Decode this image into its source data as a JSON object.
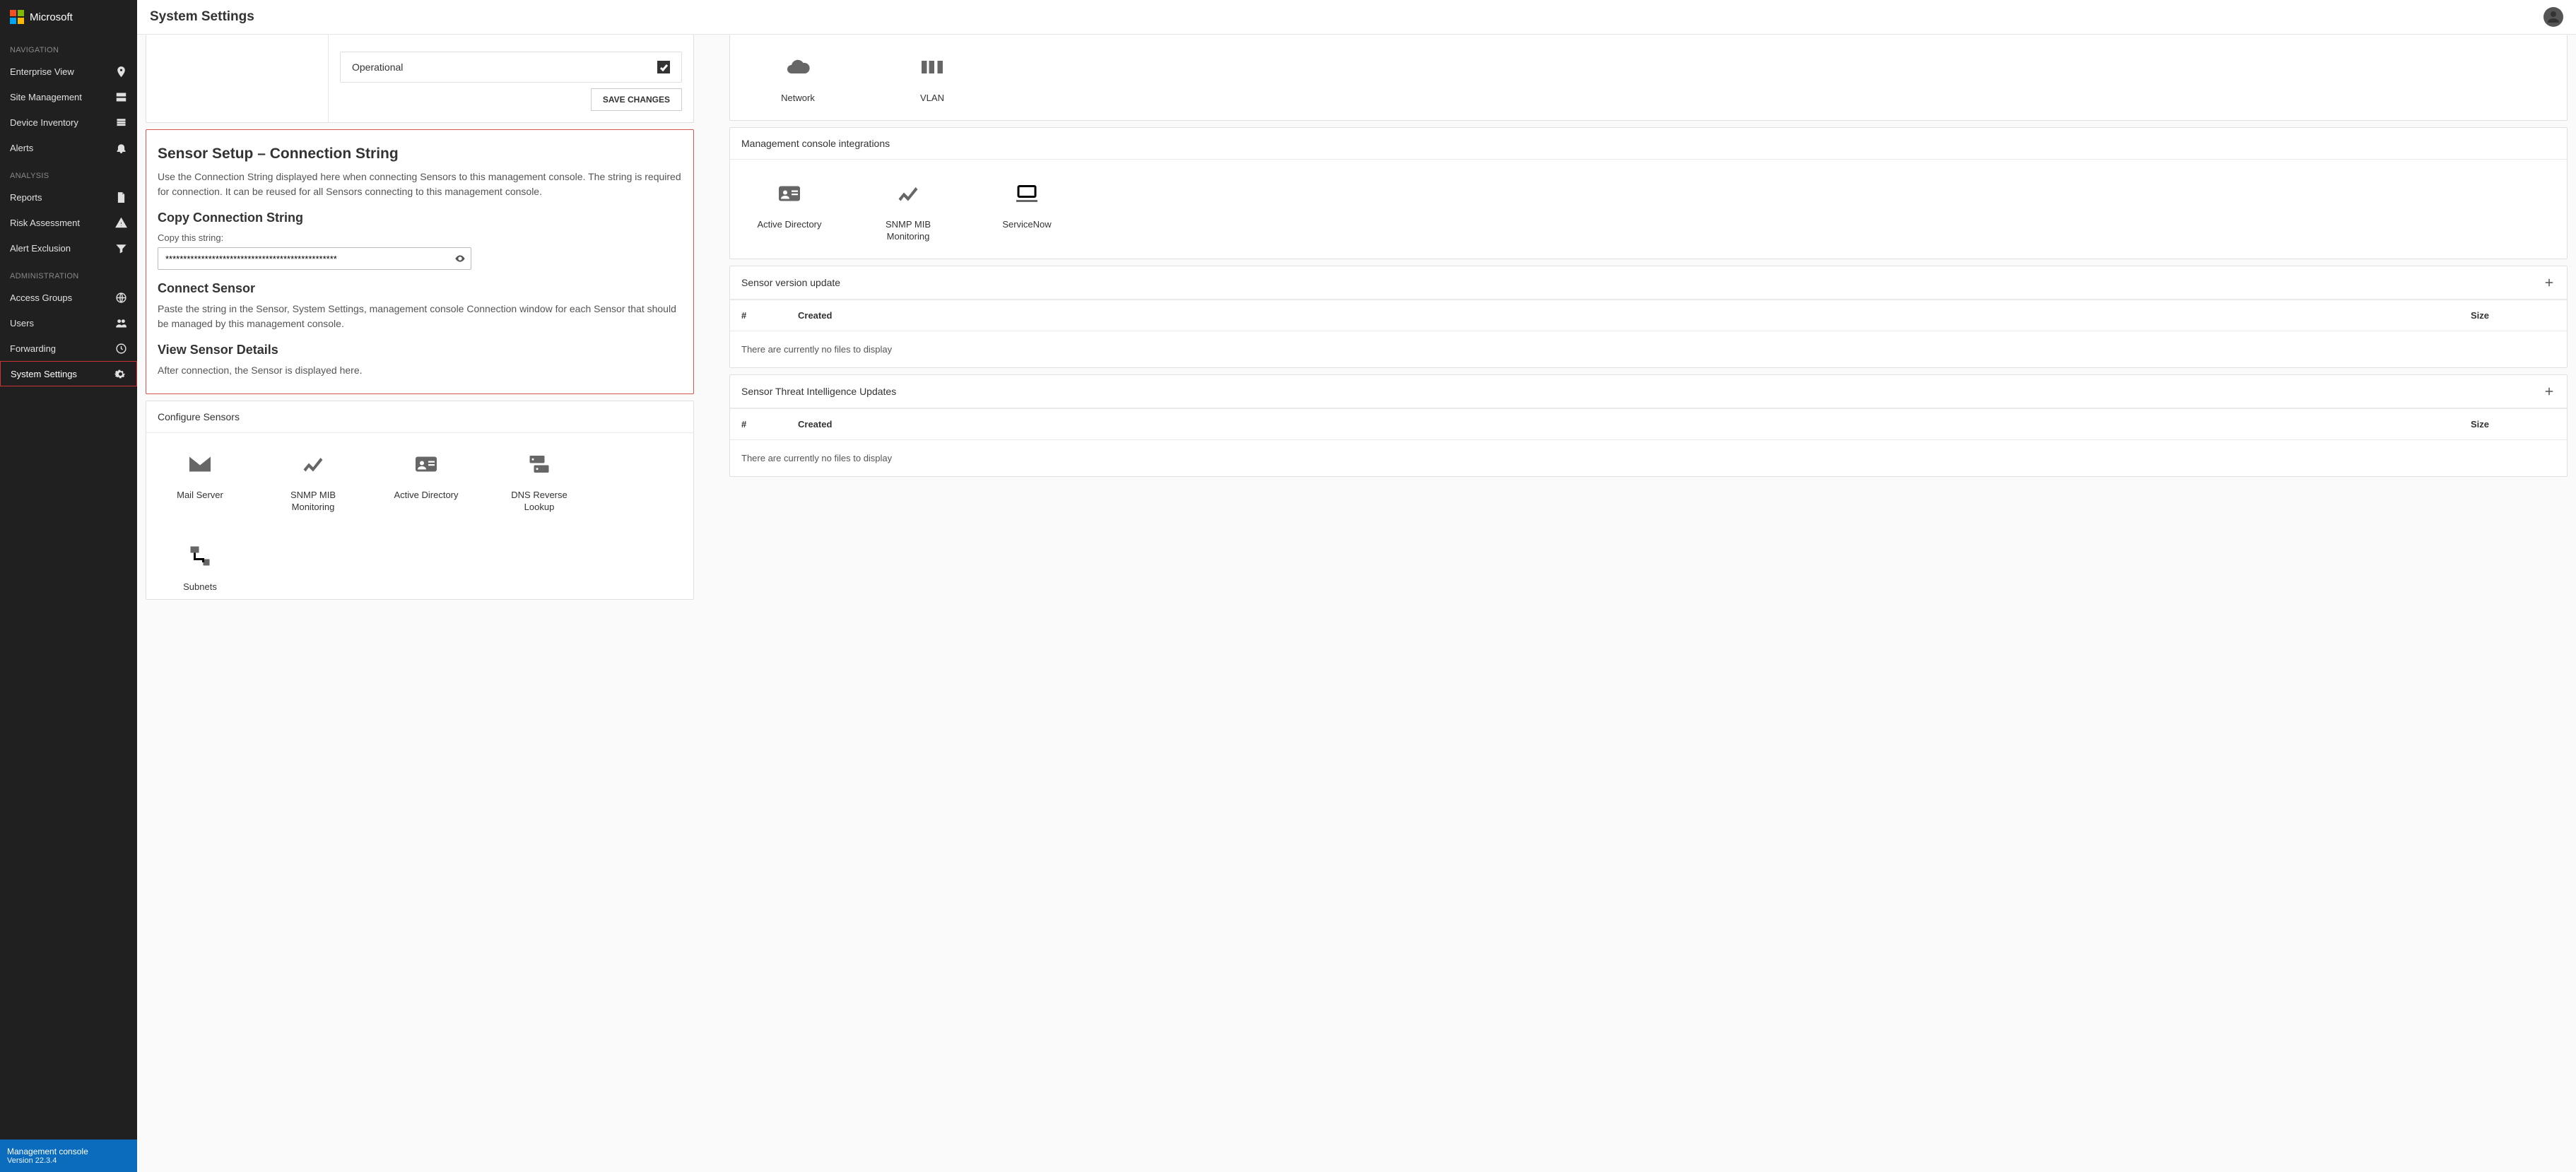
{
  "brand": {
    "name": "Microsoft"
  },
  "page_title": "System Settings",
  "sidebar": {
    "sections": [
      {
        "label": "NAVIGATION",
        "items": [
          {
            "label": "Enterprise View",
            "icon": "pin"
          },
          {
            "label": "Site Management",
            "icon": "server"
          },
          {
            "label": "Device Inventory",
            "icon": "list"
          },
          {
            "label": "Alerts",
            "icon": "bell"
          }
        ]
      },
      {
        "label": "ANALYSIS",
        "items": [
          {
            "label": "Reports",
            "icon": "file"
          },
          {
            "label": "Risk Assessment",
            "icon": "warning"
          },
          {
            "label": "Alert Exclusion",
            "icon": "filter"
          }
        ]
      },
      {
        "label": "ADMINISTRATION",
        "items": [
          {
            "label": "Access Groups",
            "icon": "globe"
          },
          {
            "label": "Users",
            "icon": "people"
          },
          {
            "label": "Forwarding",
            "icon": "clock"
          },
          {
            "label": "System Settings",
            "icon": "gear",
            "active": true
          }
        ]
      }
    ],
    "footer": {
      "title": "Management console",
      "version": "Version 22.3.4"
    }
  },
  "left_first": {
    "operational_label": "Operational",
    "save_button": "SAVE CHANGES"
  },
  "sensor_setup": {
    "title": "Sensor Setup – Connection String",
    "desc": "Use the Connection String displayed here when connecting Sensors to this management console. The string is required for connection. It can be reused for all Sensors connecting to this management console.",
    "copy_title": "Copy Connection String",
    "copy_label": "Copy this string:",
    "connection_value": "************************************************",
    "connect_title": "Connect Sensor",
    "connect_desc": "Paste the string in the Sensor, System Settings, management console Connection window for each Sensor that should be managed by this management console.",
    "view_title": "View Sensor Details",
    "view_desc": "After connection, the Sensor is displayed here."
  },
  "configure_sensors": {
    "title": "Configure Sensors",
    "tiles": [
      {
        "label": "Mail Server",
        "icon": "mail"
      },
      {
        "label": "SNMP MIB Monitoring",
        "icon": "trend"
      },
      {
        "label": "Active Directory",
        "icon": "idcard"
      },
      {
        "label": "DNS Reverse Lookup",
        "icon": "dns"
      },
      {
        "label": "Subnets",
        "icon": "subnets"
      }
    ]
  },
  "right_top_tiles": [
    {
      "label": "Network",
      "icon": "cloud"
    },
    {
      "label": "VLAN",
      "icon": "vlan"
    }
  ],
  "integrations": {
    "title": "Management console integrations",
    "tiles": [
      {
        "label": "Active Directory",
        "icon": "idcard"
      },
      {
        "label": "SNMP MIB Monitoring",
        "icon": "trend"
      },
      {
        "label": "ServiceNow",
        "icon": "laptop"
      }
    ]
  },
  "sensor_version": {
    "title": "Sensor version update",
    "cols": {
      "c1": "#",
      "c2": "Created",
      "c3": "Size"
    },
    "empty": "There are currently no files to display"
  },
  "sensor_threat": {
    "title": "Sensor Threat Intelligence Updates",
    "cols": {
      "c1": "#",
      "c2": "Created",
      "c3": "Size"
    },
    "empty": "There are currently no files to display"
  }
}
